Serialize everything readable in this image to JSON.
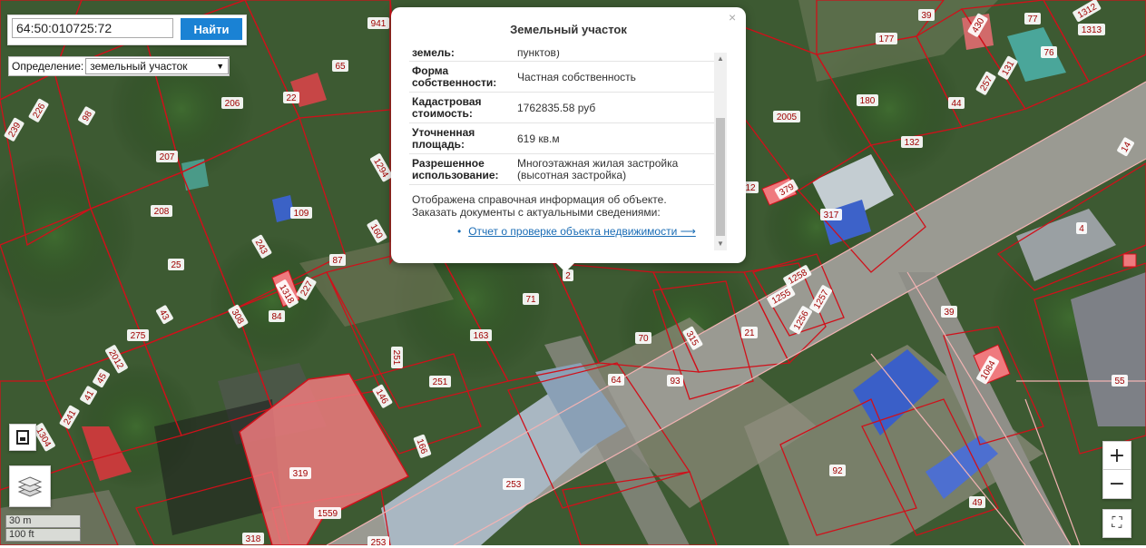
{
  "search": {
    "value": "64:50:010725:72",
    "button_label": "Найти"
  },
  "definition": {
    "label": "Определение:",
    "selected": "земельный участок"
  },
  "popup": {
    "title": "Земельный участок",
    "close_glyph": "×",
    "cut_label": "земель:",
    "cut_value": "пунктов)",
    "rows": [
      {
        "label": "Форма собственности:",
        "value": "Частная собственность"
      },
      {
        "label": "Кадастровая стоимость:",
        "value": "1762835.58 руб"
      },
      {
        "label": "Уточненная площадь:",
        "value": "619 кв.м"
      },
      {
        "label": "Разрешенное использование:",
        "value": "Многоэтажная жилая застройка (высотная застройка)"
      }
    ],
    "note": "Отображена справочная информация об объекте. Заказать документы с актуальными сведениями:",
    "link": "Отчет о проверке объекта недвижимости ⟶"
  },
  "controls": {
    "zoom_in": "+",
    "zoom_out": "−",
    "fullscreen": "⛶"
  },
  "scale": {
    "metric": "30 m",
    "imperial": "100 ft"
  },
  "parcels": [
    {
      "label": "941"
    },
    {
      "label": "65"
    },
    {
      "label": "22"
    },
    {
      "label": "206"
    },
    {
      "label": "226"
    },
    {
      "label": "98"
    },
    {
      "label": "239"
    },
    {
      "label": "207"
    },
    {
      "label": "208"
    },
    {
      "label": "109"
    },
    {
      "label": "1294"
    },
    {
      "label": "160"
    },
    {
      "label": "243"
    },
    {
      "label": "25"
    },
    {
      "label": "87"
    },
    {
      "label": "1318"
    },
    {
      "label": "227"
    },
    {
      "label": "308"
    },
    {
      "label": "84"
    },
    {
      "label": "43"
    },
    {
      "label": "275"
    },
    {
      "label": "2012"
    },
    {
      "label": "45"
    },
    {
      "label": "41"
    },
    {
      "label": "241"
    },
    {
      "label": "1304"
    },
    {
      "label": "71"
    },
    {
      "label": "2"
    },
    {
      "label": "163"
    },
    {
      "label": "251"
    },
    {
      "label": "251"
    },
    {
      "label": "146"
    },
    {
      "label": "70"
    },
    {
      "label": "315"
    },
    {
      "label": "21"
    },
    {
      "label": "64"
    },
    {
      "label": "93"
    },
    {
      "label": "166"
    },
    {
      "label": "319"
    },
    {
      "label": "1559"
    },
    {
      "label": "253"
    },
    {
      "label": "318"
    },
    {
      "label": "253"
    },
    {
      "label": "39"
    },
    {
      "label": "430"
    },
    {
      "label": "77"
    },
    {
      "label": "1312"
    },
    {
      "label": "1313"
    },
    {
      "label": "177"
    },
    {
      "label": "76"
    },
    {
      "label": "131"
    },
    {
      "label": "257"
    },
    {
      "label": "180"
    },
    {
      "label": "44"
    },
    {
      "label": "2005"
    },
    {
      "label": "132"
    },
    {
      "label": "14"
    },
    {
      "label": "12"
    },
    {
      "label": "379"
    },
    {
      "label": "317"
    },
    {
      "label": "4"
    },
    {
      "label": "1258"
    },
    {
      "label": "1255"
    },
    {
      "label": "1257"
    },
    {
      "label": "1256"
    },
    {
      "label": "39"
    },
    {
      "label": "1084"
    },
    {
      "label": "55"
    },
    {
      "label": "92"
    },
    {
      "label": "49"
    }
  ],
  "colors": {
    "parcel_border": "#d0101a",
    "selected_fill": "#ef7a7e",
    "button": "#1a82d4",
    "link": "#1a6cb5",
    "road": "#f2b3b3"
  }
}
